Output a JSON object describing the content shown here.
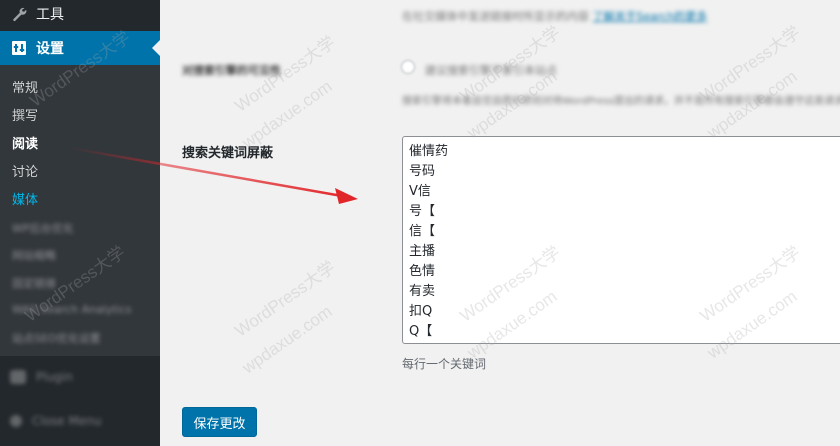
{
  "sidebar": {
    "tools": {
      "label": "工具",
      "icon": "wrench-icon"
    },
    "settings": {
      "label": "设置",
      "icon": "settings-icon"
    },
    "submenu": [
      {
        "label": "常规"
      },
      {
        "label": "撰写"
      },
      {
        "label": "阅读"
      },
      {
        "label": "讨论"
      },
      {
        "label": "媒体"
      },
      {
        "label": "WP后台优化"
      },
      {
        "label": "网站缩略"
      },
      {
        "label": "固定链接"
      },
      {
        "label": "WAS Search Analytics"
      },
      {
        "label": "站点SEO优化设置"
      }
    ],
    "blurred_top_items": [
      {
        "label": "Plugin"
      },
      {
        "label": "Close Menu"
      }
    ]
  },
  "main": {
    "blurred_note": "在社交媒体中发送链接时所显示的内容",
    "blurred_link": "了解关于Search的更多",
    "blurred_option_label": "对搜索引擎的可见性",
    "blurred_checkbox_label": "建议搜索引擎不索引本站点",
    "blurred_help": "搜索引擎将本着自觉自愿的原则对待WordPress提出的请求。并不是所有搜索引擎都会遵守这类请求。",
    "field_label": "搜索关键词屏蔽",
    "keywords": "催情药\n号码\nV信\n号【\n信【\n主播\n色情\n有卖\n扣Q\nQ【",
    "field_description": "每行一个关键词",
    "save_button": "保存更改"
  },
  "watermark": {
    "cn": "WordPress大学",
    "url": "wpdaxue.com"
  },
  "colors": {
    "sidebar_bg": "#23282d",
    "submenu_bg": "#32373c",
    "accent": "#0073aa",
    "hover_link": "#00b9eb",
    "arrow": "#e1262a"
  }
}
